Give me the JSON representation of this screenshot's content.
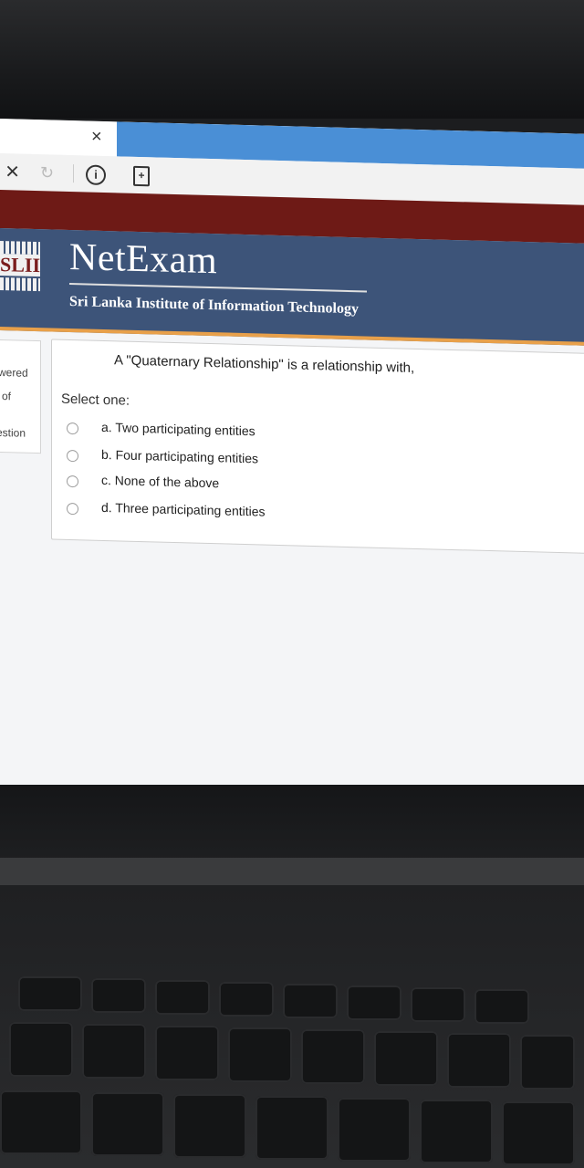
{
  "browser": {
    "tab_close_glyph": "×",
    "stop_glyph": "×",
    "reload_glyph": "↻",
    "info_glyph": "i",
    "page_glyph": "+"
  },
  "site": {
    "logo_text": "SLIIT",
    "brand": "NetExam",
    "institute": "Sri Lanka Institute of Information Technology"
  },
  "nav": {
    "fragments": [
      "wered",
      "of",
      "estion"
    ]
  },
  "question": {
    "text": "A \"Quaternary Relationship\" is a relationship with,",
    "select_label": "Select one:",
    "options": [
      "a. Two participating entities",
      "b. Four participating entities",
      "c. None of the above",
      "d. Three participating entities"
    ]
  },
  "colors": {
    "header_blue": "#3d5479",
    "maroon": "#6e1a16",
    "accent_orange": "#e8a04a",
    "tab_blue": "#4a8fd6"
  }
}
